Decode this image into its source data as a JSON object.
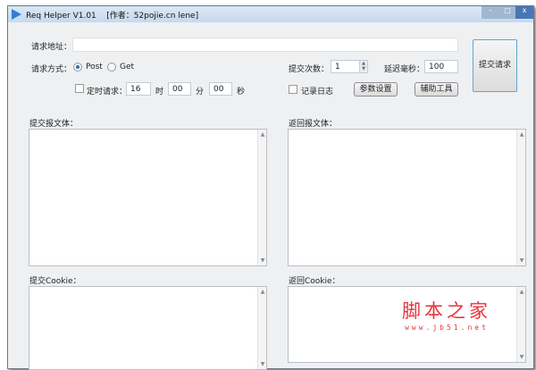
{
  "window": {
    "title": "Req Helper V1.01    [作者：52pojie.cn lene]",
    "minimize": "–",
    "maximize": "□",
    "close": "x"
  },
  "form": {
    "url_label": "请求地址：",
    "url_value": "",
    "method_label": "请求方式：",
    "method_post": "Post",
    "method_get": "Get",
    "method_selected": "Post",
    "timer_label": "定时请求：",
    "hour": "16",
    "hour_unit": "时",
    "minute": "00",
    "minute_unit": "分",
    "second": "00",
    "second_unit": "秒",
    "count_label": "提交次数：",
    "count_value": "1",
    "delay_label": "延迟毫秒：",
    "delay_value": "100",
    "log_label": "记录日志",
    "params_button": "参数设置",
    "tools_button": "辅助工具",
    "submit_button": "提交请求"
  },
  "panels": {
    "req_body_label": "提交报文体：",
    "resp_body_label": "返回报文体：",
    "req_cookie_label": "提交Cookie：",
    "resp_cookie_label": "返回Cookie："
  },
  "watermark": {
    "title": "脚本之家",
    "url": "www.jb51.net",
    "color": "#e8333a"
  }
}
